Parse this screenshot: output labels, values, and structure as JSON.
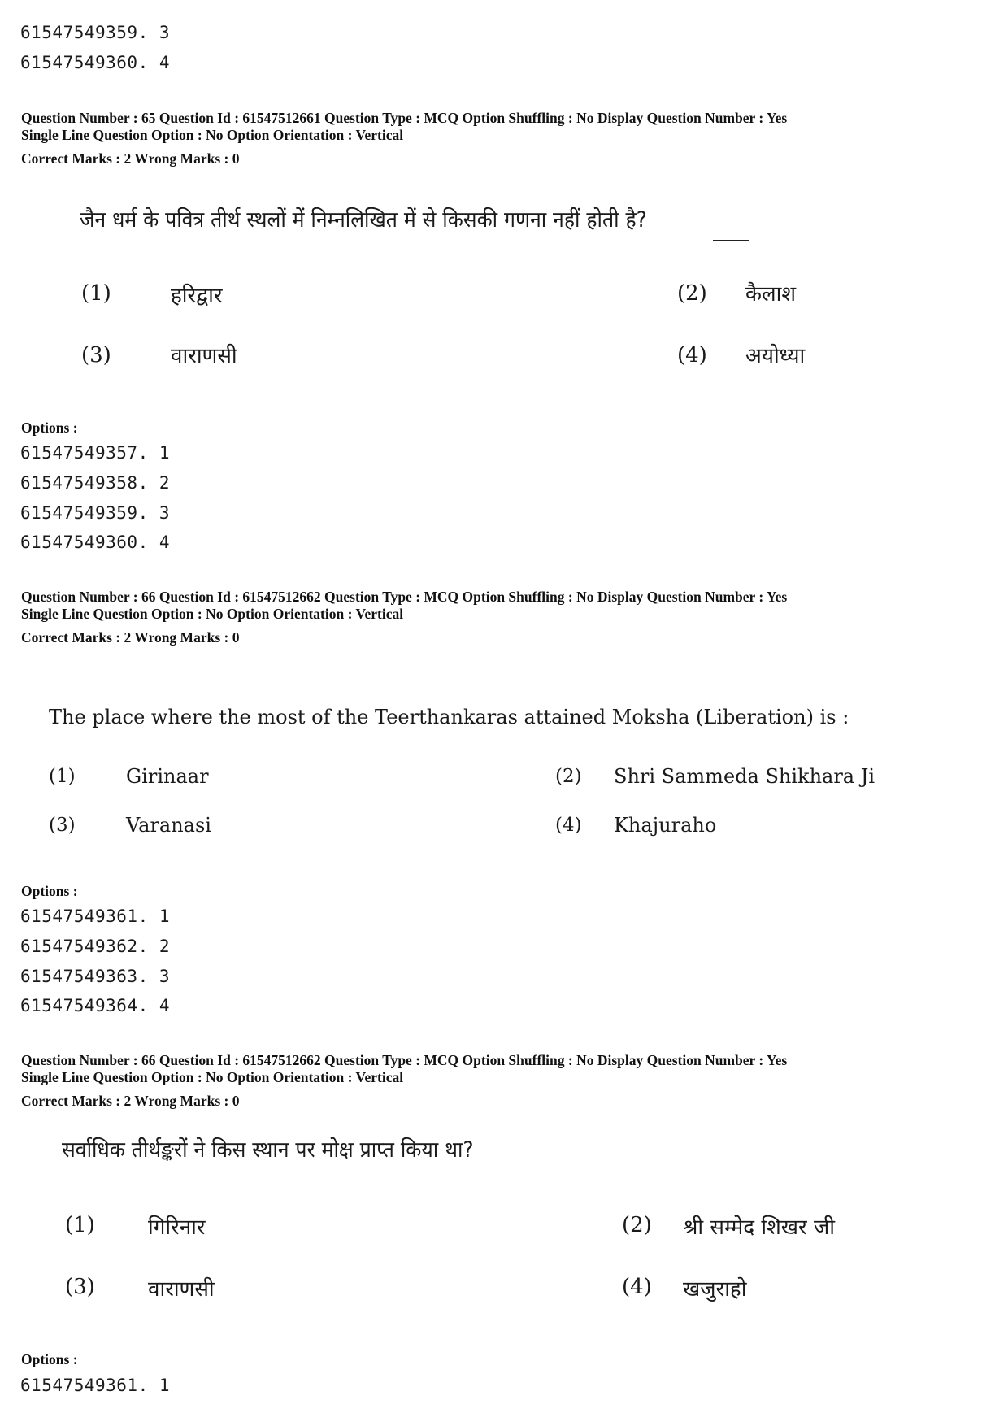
{
  "top_options": [
    {
      "id": "61547549359",
      "num": "3"
    },
    {
      "id": "61547549360",
      "num": "4"
    }
  ],
  "questions": [
    {
      "meta_line1": "Question Number : 65  Question Id : 61547512661  Question Type : MCQ  Option Shuffling : No  Display Question Number : Yes",
      "meta_line2": "Single Line Question Option : No  Option Orientation : Vertical",
      "marks": "Correct Marks : 2  Wrong Marks : 0",
      "language": "hi",
      "question_text": "जैन धर्म के पवित्र तीर्थ स्थलों में निम्नलिखित में से किसकी गणना नहीं होती है?",
      "underlined_word": "नहीं",
      "choices": [
        {
          "num": "(1)",
          "text": "हरिद्वार"
        },
        {
          "num": "(2)",
          "text": "कैलाश"
        },
        {
          "num": "(3)",
          "text": "वाराणसी"
        },
        {
          "num": "(4)",
          "text": "अयोध्या"
        }
      ],
      "options_label": "Options :",
      "options": [
        {
          "id": "61547549357",
          "num": "1"
        },
        {
          "id": "61547549358",
          "num": "2"
        },
        {
          "id": "61547549359",
          "num": "3"
        },
        {
          "id": "61547549360",
          "num": "4"
        }
      ]
    },
    {
      "meta_line1": "Question Number : 66  Question Id : 61547512662  Question Type : MCQ  Option Shuffling : No  Display Question Number : Yes",
      "meta_line2": "Single Line Question Option : No  Option Orientation : Vertical",
      "marks": "Correct Marks : 2  Wrong Marks : 0",
      "language": "en",
      "question_text": "The place where the most of the  Teerthankaras attained Moksha (Liberation) is :",
      "choices": [
        {
          "num": "(1)",
          "text": "Girinaar"
        },
        {
          "num": "(2)",
          "text": "Shri Sammeda Shikhara Ji"
        },
        {
          "num": "(3)",
          "text": "Varanasi"
        },
        {
          "num": "(4)",
          "text": "Khajuraho"
        }
      ],
      "options_label": "Options :",
      "options": [
        {
          "id": "61547549361",
          "num": "1"
        },
        {
          "id": "61547549362",
          "num": "2"
        },
        {
          "id": "61547549363",
          "num": "3"
        },
        {
          "id": "61547549364",
          "num": "4"
        }
      ]
    },
    {
      "meta_line1": "Question Number : 66  Question Id : 61547512662  Question Type : MCQ  Option Shuffling : No  Display Question Number : Yes",
      "meta_line2": "Single Line Question Option : No  Option Orientation : Vertical",
      "marks": "Correct Marks : 2  Wrong Marks : 0",
      "language": "hi",
      "question_text": "सर्वाधिक तीर्थङ्करों ने किस स्थान पर मोक्ष प्राप्त किया था?",
      "choices": [
        {
          "num": "(1)",
          "text": "गिरिनार"
        },
        {
          "num": "(2)",
          "text": "श्री सम्मेद शिखर जी"
        },
        {
          "num": "(3)",
          "text": "वाराणसी"
        },
        {
          "num": "(4)",
          "text": "खजुराहो"
        }
      ],
      "options_label": "Options :",
      "options": [
        {
          "id": "61547549361",
          "num": "1"
        }
      ]
    }
  ]
}
